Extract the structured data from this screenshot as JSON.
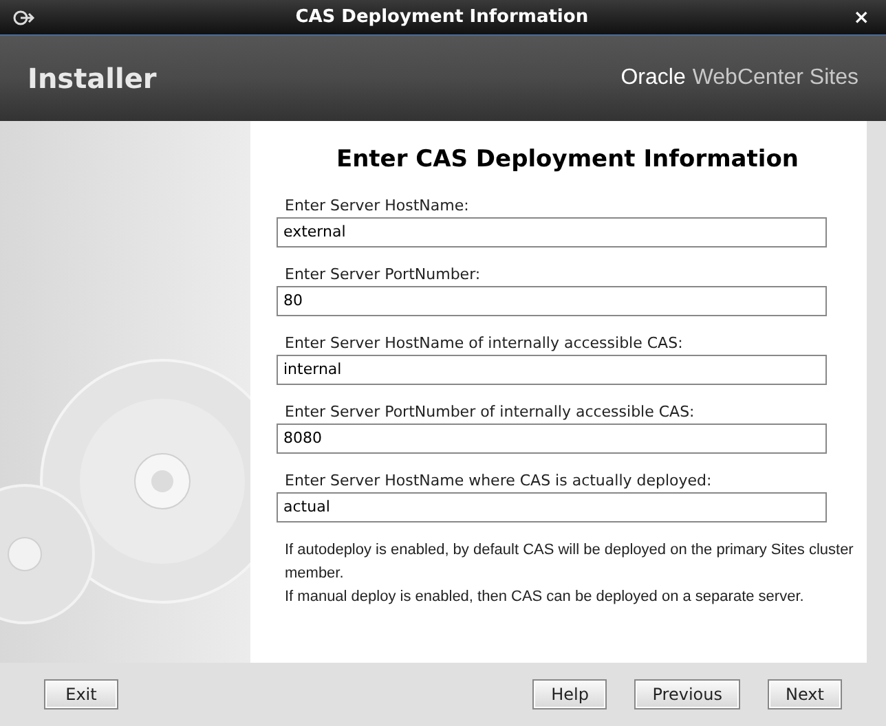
{
  "window": {
    "title": "CAS Deployment Information",
    "close": "×"
  },
  "header": {
    "title": "Installer",
    "brand": "Oracle",
    "product": "WebCenter Sites"
  },
  "form": {
    "heading": "Enter CAS Deployment Information",
    "fields": [
      {
        "label": "Enter Server HostName:",
        "value": "external"
      },
      {
        "label": "Enter Server PortNumber:",
        "value": "80"
      },
      {
        "label": "Enter Server HostName of internally accessible CAS:",
        "value": "internal"
      },
      {
        "label": "Enter Server PortNumber of internally accessible CAS:",
        "value": "8080"
      },
      {
        "label": "Enter Server HostName where CAS is actually deployed:",
        "value": "actual"
      }
    ],
    "notes": [
      "If autodeploy is enabled, by default CAS will be deployed on the primary Sites cluster member.",
      "If manual deploy is enabled, then CAS can be deployed on a separate server."
    ]
  },
  "footer": {
    "left_buttons": [
      "Exit"
    ],
    "right_buttons": [
      "Help",
      "Previous",
      "Next"
    ]
  }
}
